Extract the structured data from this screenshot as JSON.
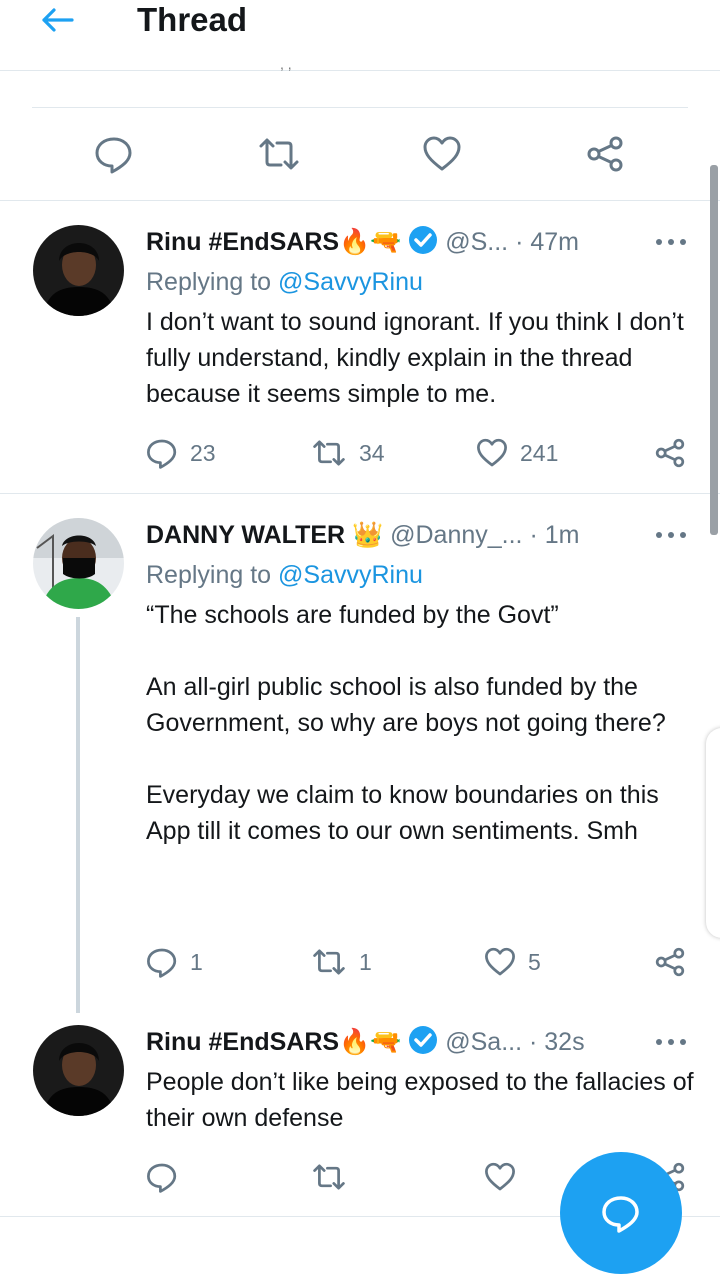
{
  "header": {
    "title": "Thread",
    "back_icon": "arrow-left-icon",
    "truncated_text": ",             ,"
  },
  "main_actions": {
    "icons": [
      "reply-icon",
      "retweet-icon",
      "like-icon",
      "share-icon"
    ]
  },
  "tweets": [
    {
      "name": "Rinu #EndSARS🔥🔫",
      "handle": "@S...",
      "time": "· 47m",
      "replying_prefix": "Replying to ",
      "replying_to": "@SavvyRinu",
      "body": "I don’t want to sound ignorant. If you think I don’t fully understand, kindly explain in the thread because it seems simple to me.",
      "replies": "23",
      "retweets": "34",
      "likes": "241"
    },
    {
      "name": "DANNY WALTER 👑",
      "handle": "@Danny_...",
      "time": "· 1m",
      "replying_prefix": "Replying to ",
      "replying_to": "@SavvyRinu",
      "body": "“The schools are funded by the Govt”\n\nAn all-girl public school is also funded by the Government, so why are boys not going there?\n\nEveryday we claim to know boundaries on this App till it comes to our own sentiments. Smh",
      "replies": "1",
      "retweets": "1",
      "likes": "5"
    },
    {
      "name": "Rinu #EndSARS🔥🔫",
      "handle": "@Sa...",
      "time": "· 32s",
      "body": "People don’t like being exposed to the fallacies of their own defense",
      "replies": "",
      "retweets": "",
      "likes": ""
    }
  ],
  "colors": {
    "accent": "#1da1f2",
    "muted": "#657786",
    "text": "#14171a",
    "divider": "#e1e8ed"
  }
}
